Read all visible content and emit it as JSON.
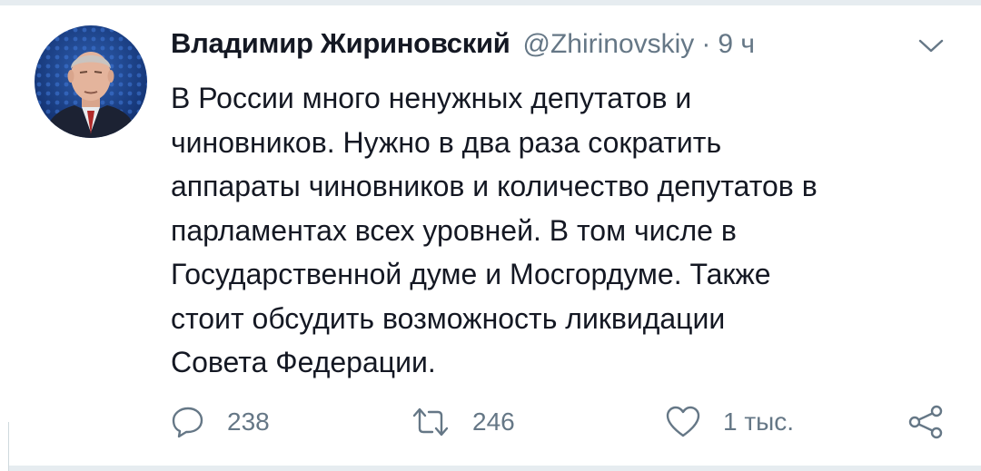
{
  "tweet": {
    "author_name": "Владимир Жириновский",
    "handle": "@Zhirinovskiy",
    "separator": "·",
    "time": "9 ч",
    "lines": [
      "В России много ненужных депутатов и",
      "чиновников. Нужно в два раза сократить",
      "аппараты чиновников и количество депутатов в",
      "парламентах всех уровней. В том числе в",
      "Государственной думе и Мосгордуме. Также",
      "стоит обсудить возможность ликвидации",
      "Совета Федерации."
    ]
  },
  "actions": {
    "reply_count": "238",
    "retweet_count": "246",
    "like_count": "1 тыс."
  },
  "icons": {
    "reply": "reply-icon",
    "retweet": "retweet-icon",
    "like": "heart-icon",
    "share": "share-icon",
    "menu": "chevron-down-icon"
  },
  "colors": {
    "text": "#141823",
    "secondary": "#657786",
    "divider": "#e6ecf0"
  }
}
